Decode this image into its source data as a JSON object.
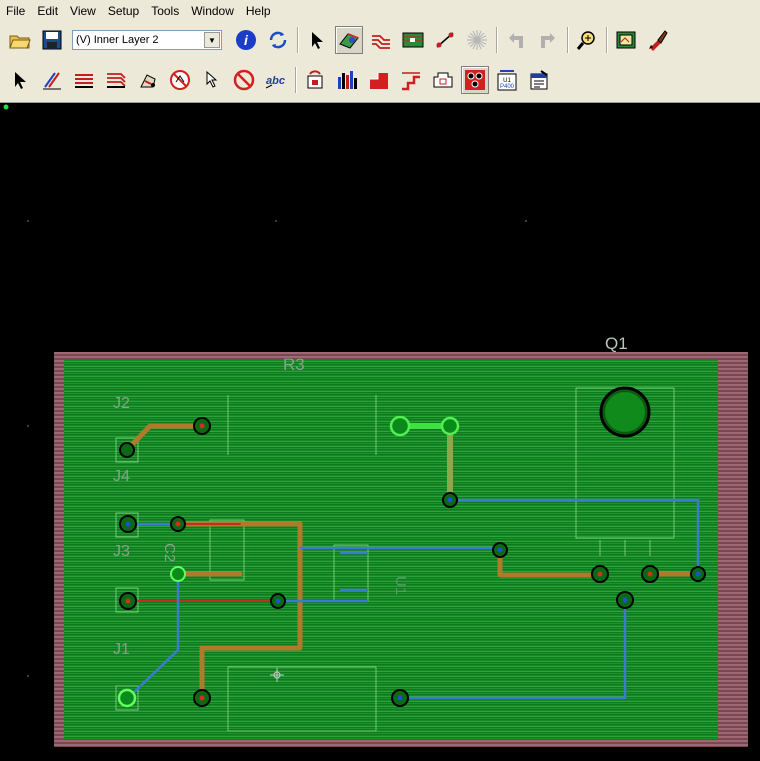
{
  "menu": [
    "File",
    "Edit",
    "View",
    "Setup",
    "Tools",
    "Window",
    "Help"
  ],
  "layer_selector": {
    "value": "(V) Inner Layer 2"
  },
  "designators": {
    "q1": "Q1",
    "r3": "R3",
    "j2": "J2",
    "j4": "J4",
    "j3": "J3",
    "j1": "J1",
    "c2": "C2",
    "u1": "U1"
  },
  "toolbar2_badge": "U1\nP400",
  "colors": {
    "board": "#0a8a1a",
    "top_trace": "#b07a2a",
    "bottom_trace": "#3a7bd0",
    "border": "#d0a0a8"
  }
}
